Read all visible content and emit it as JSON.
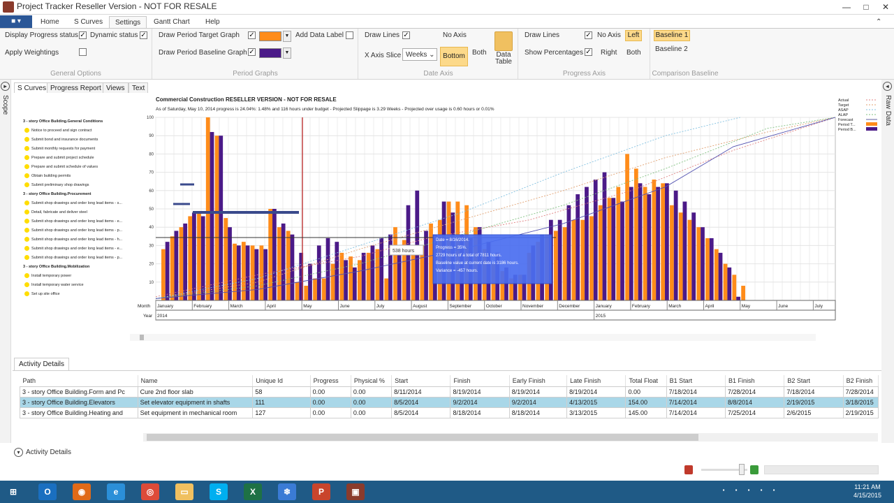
{
  "window": {
    "title": "Project Tracker Reseller Version - NOT FOR RESALE"
  },
  "ribbon": {
    "file_label": "",
    "tabs": [
      "Home",
      "S Curves",
      "Settings",
      "Gantt Chart",
      "Help"
    ],
    "active_tab": "Settings",
    "general_options": {
      "display_progress_status": "Display Progress status",
      "dynamic_status": "Dynamic status",
      "apply_weightings": "Apply Weightings",
      "label": "General Options"
    },
    "period_graphs": {
      "draw_target": "Draw Period Target Graph",
      "draw_baseline": "Draw Period Baseline Graph",
      "add_data_label": "Add Data Label",
      "target_color": "#ff8c1a",
      "baseline_color": "#4b1a88",
      "label": "Period Graphs"
    },
    "date_axis": {
      "draw_lines": "Draw Lines",
      "no_axis": "No Axis",
      "x_axis_slice": "X Axis Slice",
      "slice_value": "Weeks",
      "bottom": "Bottom",
      "both": "Both",
      "data_table": "Data Table",
      "label": "Date Axis"
    },
    "progress_axis": {
      "draw_lines": "Draw Lines",
      "no_axis": "No Axis",
      "left": "Left",
      "show_percentages": "Show Percentages",
      "right": "Right",
      "both": "Both",
      "label": "Progress Axis"
    },
    "comparison_baseline": {
      "baseline1": "Baseline 1",
      "baseline2": "Baseline 2",
      "label": "Comparison Baseline"
    }
  },
  "side": {
    "left_label": "Scope",
    "right_label": "Raw Data"
  },
  "content_tabs": [
    "S Curves",
    "Progress Report",
    "Views",
    "Text"
  ],
  "chart_data": {
    "type": "bar",
    "title": "Commercial Construction RESELLER VERSION - NOT FOR RESALE",
    "subtitle": "As of  Saturday, May 10, 2014 progress is  24.04%: 1.48%  and  116 hours under budget   - Projected Slippage is  3.29 Weeks   - Projected over usage is  0.60 hours or 0.01%",
    "y_ticks": [
      "100",
      "90",
      "80",
      "70",
      "60",
      "50",
      "40",
      "30",
      "20",
      "10"
    ],
    "ylim": [
      0,
      100
    ],
    "months_row_label": "Month",
    "year_row_label": "Year",
    "months": [
      "January",
      "February",
      "March",
      "April",
      "May",
      "June",
      "July",
      "August",
      "September",
      "October",
      "November",
      "December",
      "January",
      "February",
      "March",
      "April",
      "May",
      "June",
      "July"
    ],
    "years": [
      "2014",
      "2015"
    ],
    "legend": [
      "Actual",
      "Target",
      "ASAP",
      "ALAP",
      "Forecast",
      "Period T...",
      "Period B..."
    ],
    "legend_colors": [
      "#e08080",
      "#e0a070",
      "#80c0e0",
      "#80c080",
      "#6060a0",
      "#ff8c1a",
      "#4b1a88"
    ],
    "tooltip_small": "538 hours",
    "tooltip_lines": [
      "Date = 8/16/2014.",
      "Progress = 35%.",
      "2729 hours of a total of 7811 hours.",
      "Baseline value at current date is 3186 hours.",
      "Variance = -457 hours."
    ],
    "series": [
      {
        "name": "Period T...",
        "values": [
          28,
          35,
          40,
          46,
          48,
          100,
          90,
          45,
          31,
          32,
          30,
          30,
          50,
          40,
          38,
          10,
          8,
          12,
          12,
          20,
          26,
          24,
          22,
          26,
          28,
          12,
          40,
          33,
          28,
          30,
          42,
          44,
          54,
          54,
          52,
          40,
          28,
          20,
          16,
          12,
          14,
          26,
          32,
          36,
          38,
          40,
          44,
          44,
          46,
          52,
          56,
          62,
          80,
          72,
          62,
          66,
          64,
          52,
          48,
          44,
          40,
          34,
          28,
          20,
          14,
          8
        ]
      },
      {
        "name": "Period B...",
        "values": [
          32,
          38,
          42,
          48,
          46,
          92,
          90,
          40,
          30,
          30,
          28,
          28,
          50,
          42,
          36,
          26,
          20,
          30,
          34,
          32,
          22,
          18,
          26,
          30,
          34,
          36,
          28,
          52,
          60,
          38,
          36,
          54,
          48,
          36,
          34,
          40,
          32,
          26,
          18,
          14,
          14,
          30,
          36,
          44,
          44,
          52,
          58,
          62,
          66,
          70,
          56,
          54,
          62,
          64,
          58,
          62,
          64,
          60,
          54,
          48,
          40,
          34,
          26,
          18,
          2,
          0
        ]
      }
    ]
  },
  "tree": [
    {
      "text": "3 - story Office Building.General Conditions",
      "header": true
    },
    {
      "text": "Notice to proceed and sign contract",
      "header": false
    },
    {
      "text": "Submit bond and insurance documents",
      "header": false
    },
    {
      "text": "Submit monthly requests for payment",
      "header": false
    },
    {
      "text": "Prepare and submit project schedule",
      "header": false
    },
    {
      "text": "Prepare and submit schedule of values",
      "header": false
    },
    {
      "text": "Obtain building permits",
      "header": false
    },
    {
      "text": "Submit preliminary shop drawings",
      "header": false
    },
    {
      "text": "3 - story Office Building.Procurement",
      "header": true
    },
    {
      "text": "Submit shop drawings and order long lead items - s...",
      "header": false
    },
    {
      "text": "Detail, fabricate and deliver steel",
      "header": false
    },
    {
      "text": "Submit shop drawings and order long lead items - e...",
      "header": false
    },
    {
      "text": "Submit shop drawings and order long lead items - p...",
      "header": false
    },
    {
      "text": "Submit shop drawings and order long lead items - h...",
      "header": false
    },
    {
      "text": "Submit shop drawings and order long lead items - e...",
      "header": false
    },
    {
      "text": "Submit shop drawings and order long lead items - p...",
      "header": false
    },
    {
      "text": "3 - story Office Building.Mobilization",
      "header": true
    },
    {
      "text": "Install temporary power",
      "header": false
    },
    {
      "text": "Install temporary water service",
      "header": false
    },
    {
      "text": "Set up site office",
      "header": false
    }
  ],
  "activity": {
    "tab_label": "Activity Details",
    "columns": [
      "Path",
      "Name",
      "Unique Id",
      "Progress",
      "Physical %",
      "Start",
      "Finish",
      "Early Finish",
      "Late Finish",
      "Total Float",
      "B1 Start",
      "B1 Finish",
      "B2 Start",
      "B2 Finish"
    ],
    "rows": [
      [
        "3 - story Office Building.Form and Pc",
        "Cure 2nd floor slab",
        "58",
        "0.00",
        "0.00",
        "8/11/2014",
        "8/19/2014",
        "8/19/2014",
        "8/19/2014",
        "0.00",
        "7/18/2014",
        "7/28/2014",
        "7/18/2014",
        "7/28/2014"
      ],
      [
        "3 - story Office Building.Elevators",
        "Set elevator equipment in shafts",
        "111",
        "0.00",
        "0.00",
        "8/5/2014",
        "9/2/2014",
        "9/2/2014",
        "4/13/2015",
        "154.00",
        "7/14/2014",
        "8/8/2014",
        "2/19/2015",
        "3/18/2015"
      ],
      [
        "3 - story Office Building.Heating and",
        "Set equipment in mechanical room",
        "127",
        "0.00",
        "0.00",
        "8/5/2014",
        "8/18/2014",
        "8/18/2014",
        "3/13/2015",
        "145.00",
        "7/14/2014",
        "7/25/2014",
        "2/6/2015",
        "2/19/2015"
      ]
    ],
    "selected_row": 1,
    "footer_label": "Activity Details"
  },
  "taskbar": {
    "apps": [
      "windows-start",
      "outlook",
      "firefox",
      "internet-explorer",
      "chrome",
      "file-explorer",
      "skype",
      "excel",
      "snowflake-app",
      "powerpoint",
      "project-tracker"
    ],
    "time": "11:21 AM",
    "date": "4/15/2015"
  }
}
